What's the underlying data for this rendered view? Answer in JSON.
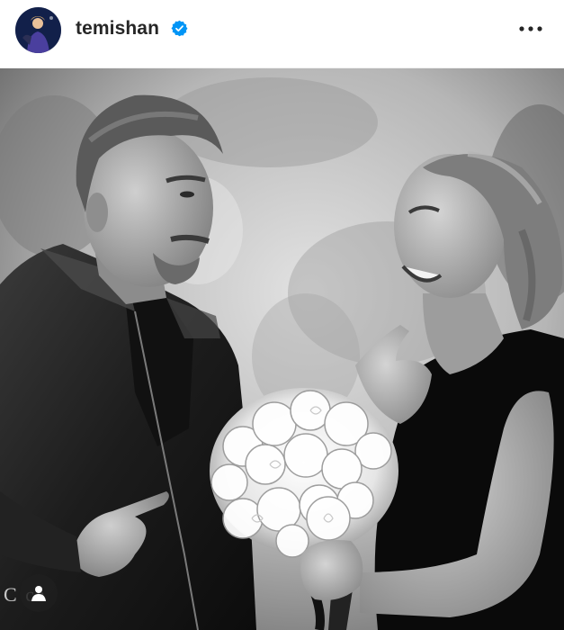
{
  "post": {
    "username": "temishan",
    "verified": true,
    "photo_caption_fragment": "C  ca"
  },
  "icons": {
    "avatar": "profile-avatar",
    "verified": "verified-badge-icon",
    "more": "more-options-icon",
    "tags": "user-tag-icon"
  },
  "colors": {
    "verified_blue": "#0095f6",
    "text": "#262626"
  }
}
